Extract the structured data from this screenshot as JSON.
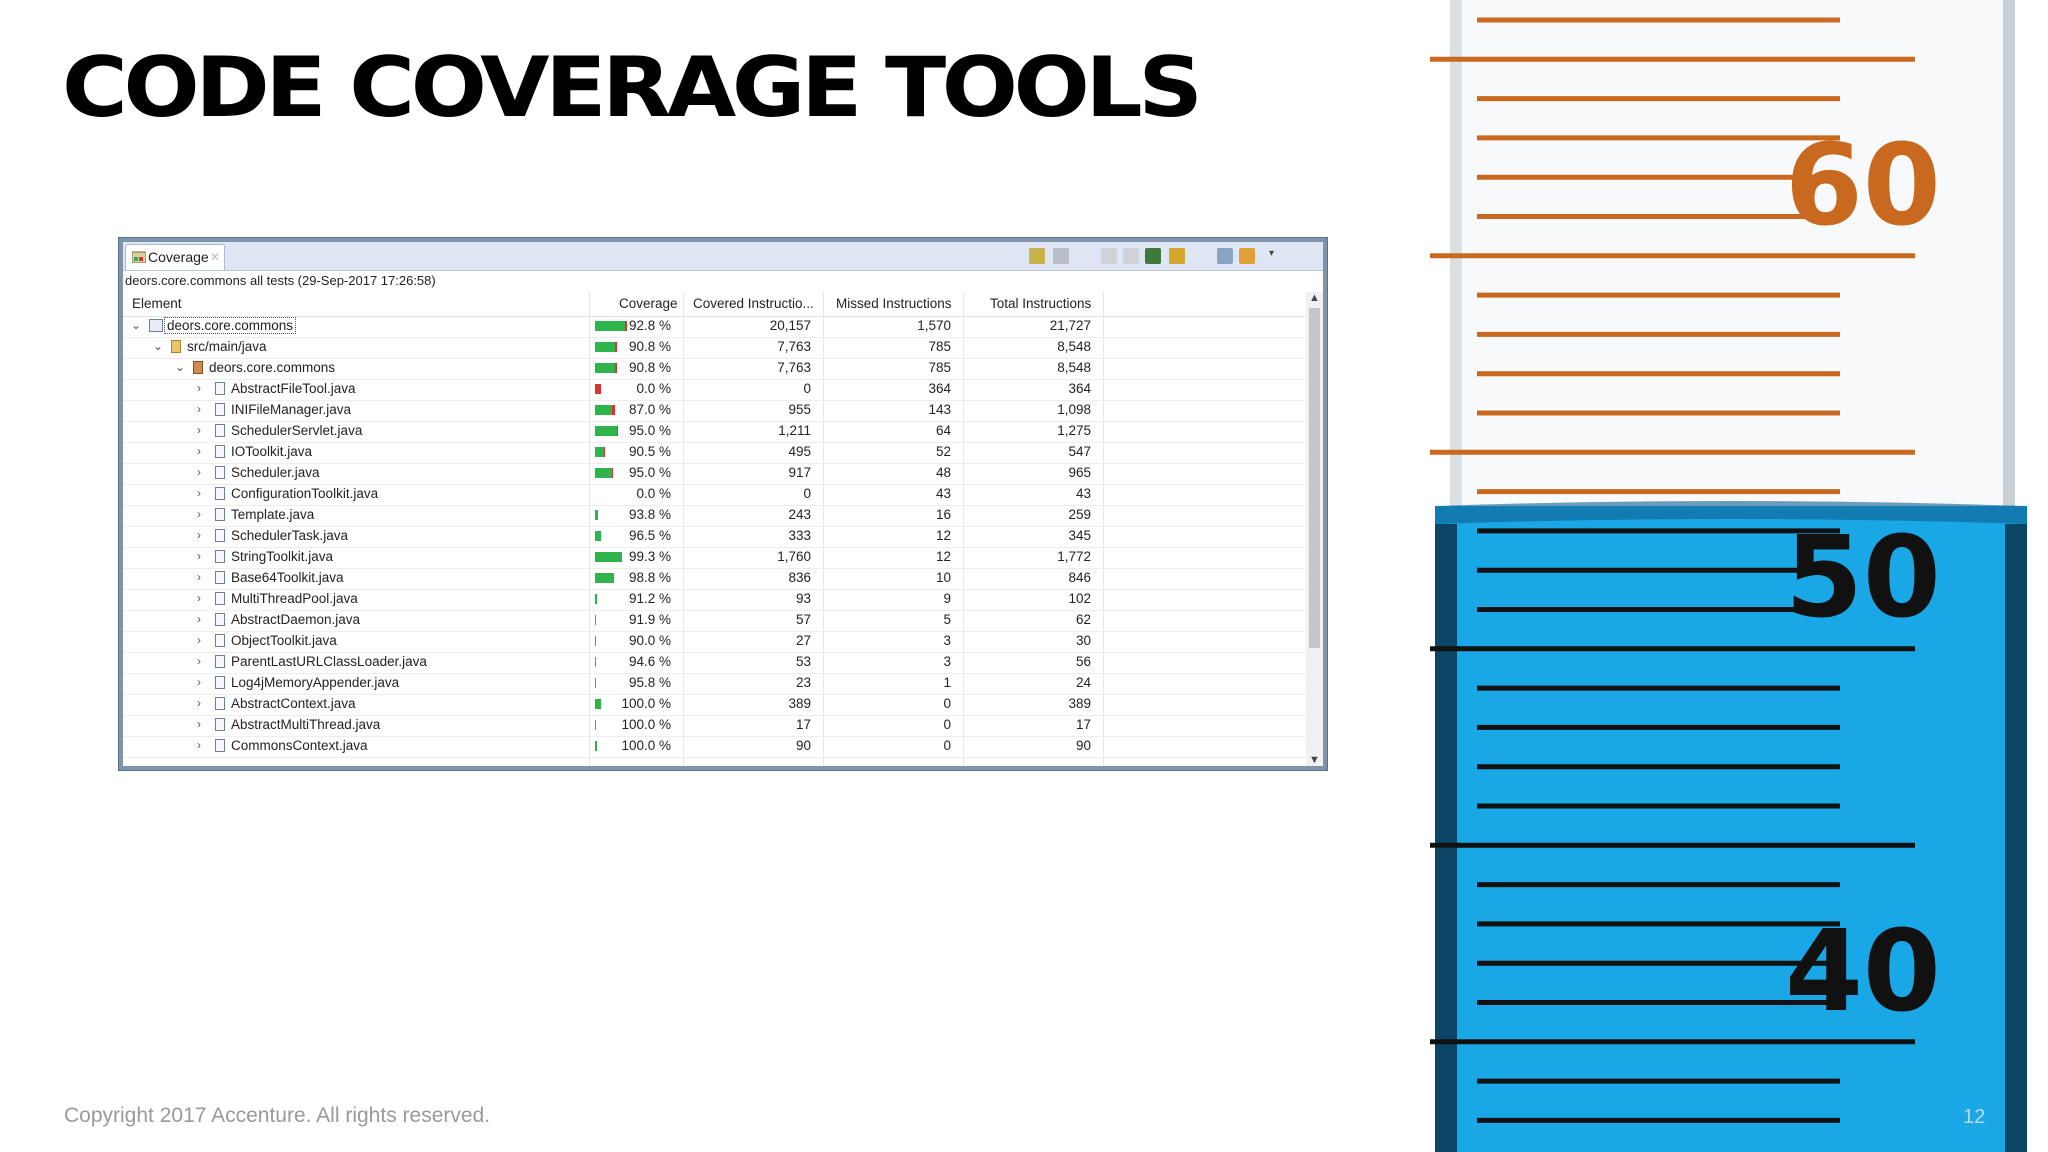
{
  "slide": {
    "title": "CODE COVERAGE TOOLS",
    "copyright": "Copyright 2017 Accenture. All rights reserved.",
    "page_number": "12"
  },
  "photo": {
    "labels": [
      "60",
      "50",
      "40"
    ],
    "liquid_color": "#1aa7e6",
    "mark_color_upper": "#c8691f",
    "mark_color_lower": "#111111"
  },
  "coverage_view": {
    "tab_label": "Coverage",
    "session_label": "deors.core.commons all tests (29-Sep-2017 17:26:58)",
    "columns": {
      "element": "Element",
      "coverage": "Coverage",
      "covered": "Covered Instructio...",
      "missed": "Missed Instructions",
      "total": "Total Instructions"
    },
    "colors": {
      "covered": "#2fb34b",
      "missed": "#e0312f"
    },
    "rows": [
      {
        "name": "deors.core.commons",
        "level": 0,
        "kind": "project",
        "expanded": true,
        "coverage_value": 92.8,
        "coverage": "92.8 %",
        "covered": "20,157",
        "missed": "1,570",
        "total": "21,727",
        "bar_fraction": 1.0
      },
      {
        "name": "src/main/java",
        "level": 1,
        "kind": "folder",
        "expanded": true,
        "coverage_value": 90.8,
        "coverage": "90.8 %",
        "covered": "7,763",
        "missed": "785",
        "total": "8,548",
        "bar_fraction": 0.68
      },
      {
        "name": "deors.core.commons",
        "level": 2,
        "kind": "package",
        "expanded": true,
        "coverage_value": 90.8,
        "coverage": "90.8 %",
        "covered": "7,763",
        "missed": "785",
        "total": "8,548",
        "bar_fraction": 0.68
      },
      {
        "name": "AbstractFileTool.java",
        "level": 3,
        "kind": "file",
        "expanded": false,
        "coverage_value": 0.0,
        "coverage": "0.0 %",
        "covered": "0",
        "missed": "364",
        "total": "364",
        "bar_fraction": 0.18
      },
      {
        "name": "INIFileManager.java",
        "level": 3,
        "kind": "file",
        "expanded": false,
        "coverage_value": 87.0,
        "coverage": "87.0 %",
        "covered": "955",
        "missed": "143",
        "total": "1,098",
        "bar_fraction": 0.62
      },
      {
        "name": "SchedulerServlet.java",
        "level": 3,
        "kind": "file",
        "expanded": false,
        "coverage_value": 95.0,
        "coverage": "95.0 %",
        "covered": "1,211",
        "missed": "64",
        "total": "1,275",
        "bar_fraction": 0.72
      },
      {
        "name": "IOToolkit.java",
        "level": 3,
        "kind": "file",
        "expanded": false,
        "coverage_value": 90.5,
        "coverage": "90.5 %",
        "covered": "495",
        "missed": "52",
        "total": "547",
        "bar_fraction": 0.3
      },
      {
        "name": "Scheduler.java",
        "level": 3,
        "kind": "file",
        "expanded": false,
        "coverage_value": 95.0,
        "coverage": "95.0 %",
        "covered": "917",
        "missed": "48",
        "total": "965",
        "bar_fraction": 0.55
      },
      {
        "name": "ConfigurationToolkit.java",
        "level": 3,
        "kind": "file",
        "expanded": false,
        "coverage_value": 0.0,
        "coverage": "0.0 %",
        "covered": "0",
        "missed": "43",
        "total": "43",
        "bar_fraction": 0.0
      },
      {
        "name": "Template.java",
        "level": 3,
        "kind": "file",
        "expanded": false,
        "coverage_value": 93.8,
        "coverage": "93.8 %",
        "covered": "243",
        "missed": "16",
        "total": "259",
        "bar_fraction": 0.1
      },
      {
        "name": "SchedulerTask.java",
        "level": 3,
        "kind": "file",
        "expanded": false,
        "coverage_value": 96.5,
        "coverage": "96.5 %",
        "covered": "333",
        "missed": "12",
        "total": "345",
        "bar_fraction": 0.18
      },
      {
        "name": "StringToolkit.java",
        "level": 3,
        "kind": "file",
        "expanded": false,
        "coverage_value": 99.3,
        "coverage": "99.3 %",
        "covered": "1,760",
        "missed": "12",
        "total": "1,772",
        "bar_fraction": 0.85
      },
      {
        "name": "Base64Toolkit.java",
        "level": 3,
        "kind": "file",
        "expanded": false,
        "coverage_value": 98.8,
        "coverage": "98.8 %",
        "covered": "836",
        "missed": "10",
        "total": "846",
        "bar_fraction": 0.58
      },
      {
        "name": "MultiThreadPool.java",
        "level": 3,
        "kind": "file",
        "expanded": false,
        "coverage_value": 91.2,
        "coverage": "91.2 %",
        "covered": "93",
        "missed": "9",
        "total": "102",
        "bar_fraction": 0.05
      },
      {
        "name": "AbstractDaemon.java",
        "level": 3,
        "kind": "file",
        "expanded": false,
        "coverage_value": 91.9,
        "coverage": "91.9 %",
        "covered": "57",
        "missed": "5",
        "total": "62",
        "bar_fraction": 0.0
      },
      {
        "name": "ObjectToolkit.java",
        "level": 3,
        "kind": "file",
        "expanded": false,
        "coverage_value": 90.0,
        "coverage": "90.0 %",
        "covered": "27",
        "missed": "3",
        "total": "30",
        "bar_fraction": 0.0
      },
      {
        "name": "ParentLastURLClassLoader.java",
        "level": 3,
        "kind": "file",
        "expanded": false,
        "coverage_value": 94.6,
        "coverage": "94.6 %",
        "covered": "53",
        "missed": "3",
        "total": "56",
        "bar_fraction": 0.0
      },
      {
        "name": "Log4jMemoryAppender.java",
        "level": 3,
        "kind": "file",
        "expanded": false,
        "coverage_value": 95.8,
        "coverage": "95.8 %",
        "covered": "23",
        "missed": "1",
        "total": "24",
        "bar_fraction": 0.0
      },
      {
        "name": "AbstractContext.java",
        "level": 3,
        "kind": "file",
        "expanded": false,
        "coverage_value": 100.0,
        "coverage": "100.0 %",
        "covered": "389",
        "missed": "0",
        "total": "389",
        "bar_fraction": 0.2
      },
      {
        "name": "AbstractMultiThread.java",
        "level": 3,
        "kind": "file",
        "expanded": false,
        "coverage_value": 100.0,
        "coverage": "100.0 %",
        "covered": "17",
        "missed": "0",
        "total": "17",
        "bar_fraction": 0.0
      },
      {
        "name": "CommonsContext.java",
        "level": 3,
        "kind": "file",
        "expanded": false,
        "coverage_value": 100.0,
        "coverage": "100.0 %",
        "covered": "90",
        "missed": "0",
        "total": "90",
        "bar_fraction": 0.05
      }
    ]
  }
}
